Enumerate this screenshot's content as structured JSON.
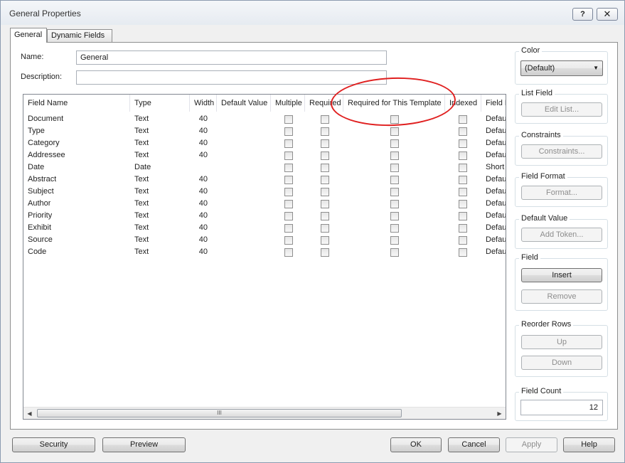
{
  "window": {
    "title": "General Properties",
    "help_label": "?",
    "close_label": "✕"
  },
  "tabs": [
    {
      "label": "General",
      "active": true
    },
    {
      "label": "Dynamic Fields",
      "active": false
    }
  ],
  "form": {
    "name_label": "Name:",
    "name_value": "General",
    "description_label": "Description:",
    "description_value": ""
  },
  "grid": {
    "columns": [
      "Field Name",
      "Type",
      "Width",
      "Default Value",
      "Multiple",
      "Required",
      "Required for This Template",
      "Indexed",
      "Field Format"
    ],
    "rows": [
      {
        "name": "Document",
        "type": "Text",
        "width": "40",
        "format": "Default"
      },
      {
        "name": "Type",
        "type": "Text",
        "width": "40",
        "format": "Default"
      },
      {
        "name": "Category",
        "type": "Text",
        "width": "40",
        "format": "Default"
      },
      {
        "name": "Addressee",
        "type": "Text",
        "width": "40",
        "format": "Default"
      },
      {
        "name": "Date",
        "type": "Date",
        "width": "",
        "format": "Short"
      },
      {
        "name": "Abstract",
        "type": "Text",
        "width": "40",
        "format": "Default"
      },
      {
        "name": "Subject",
        "type": "Text",
        "width": "40",
        "format": "Default"
      },
      {
        "name": "Author",
        "type": "Text",
        "width": "40",
        "format": "Default"
      },
      {
        "name": "Priority",
        "type": "Text",
        "width": "40",
        "format": "Default"
      },
      {
        "name": "Exhibit",
        "type": "Text",
        "width": "40",
        "format": "Default"
      },
      {
        "name": "Source",
        "type": "Text",
        "width": "40",
        "format": "Default"
      },
      {
        "name": "Code",
        "type": "Text",
        "width": "40",
        "format": "Default"
      }
    ],
    "scroll_grip": "III"
  },
  "side": {
    "color": {
      "title": "Color",
      "value": "(Default)"
    },
    "list_field": {
      "title": "List Field",
      "button": "Edit List..."
    },
    "constraints": {
      "title": "Constraints",
      "button": "Constraints..."
    },
    "field_format": {
      "title": "Field Format",
      "button": "Format..."
    },
    "default_value": {
      "title": "Default Value",
      "button": "Add Token..."
    },
    "field": {
      "title": "Field",
      "insert": "Insert",
      "remove": "Remove"
    },
    "reorder": {
      "title": "Reorder Rows",
      "up": "Up",
      "down": "Down"
    },
    "field_count": {
      "title": "Field Count",
      "value": "12"
    }
  },
  "bottom": {
    "security": "Security",
    "preview": "Preview",
    "ok": "OK",
    "cancel": "Cancel",
    "apply": "Apply",
    "help": "Help"
  },
  "colors": {
    "annotation": "#e02020",
    "accent_border": "#707070"
  }
}
